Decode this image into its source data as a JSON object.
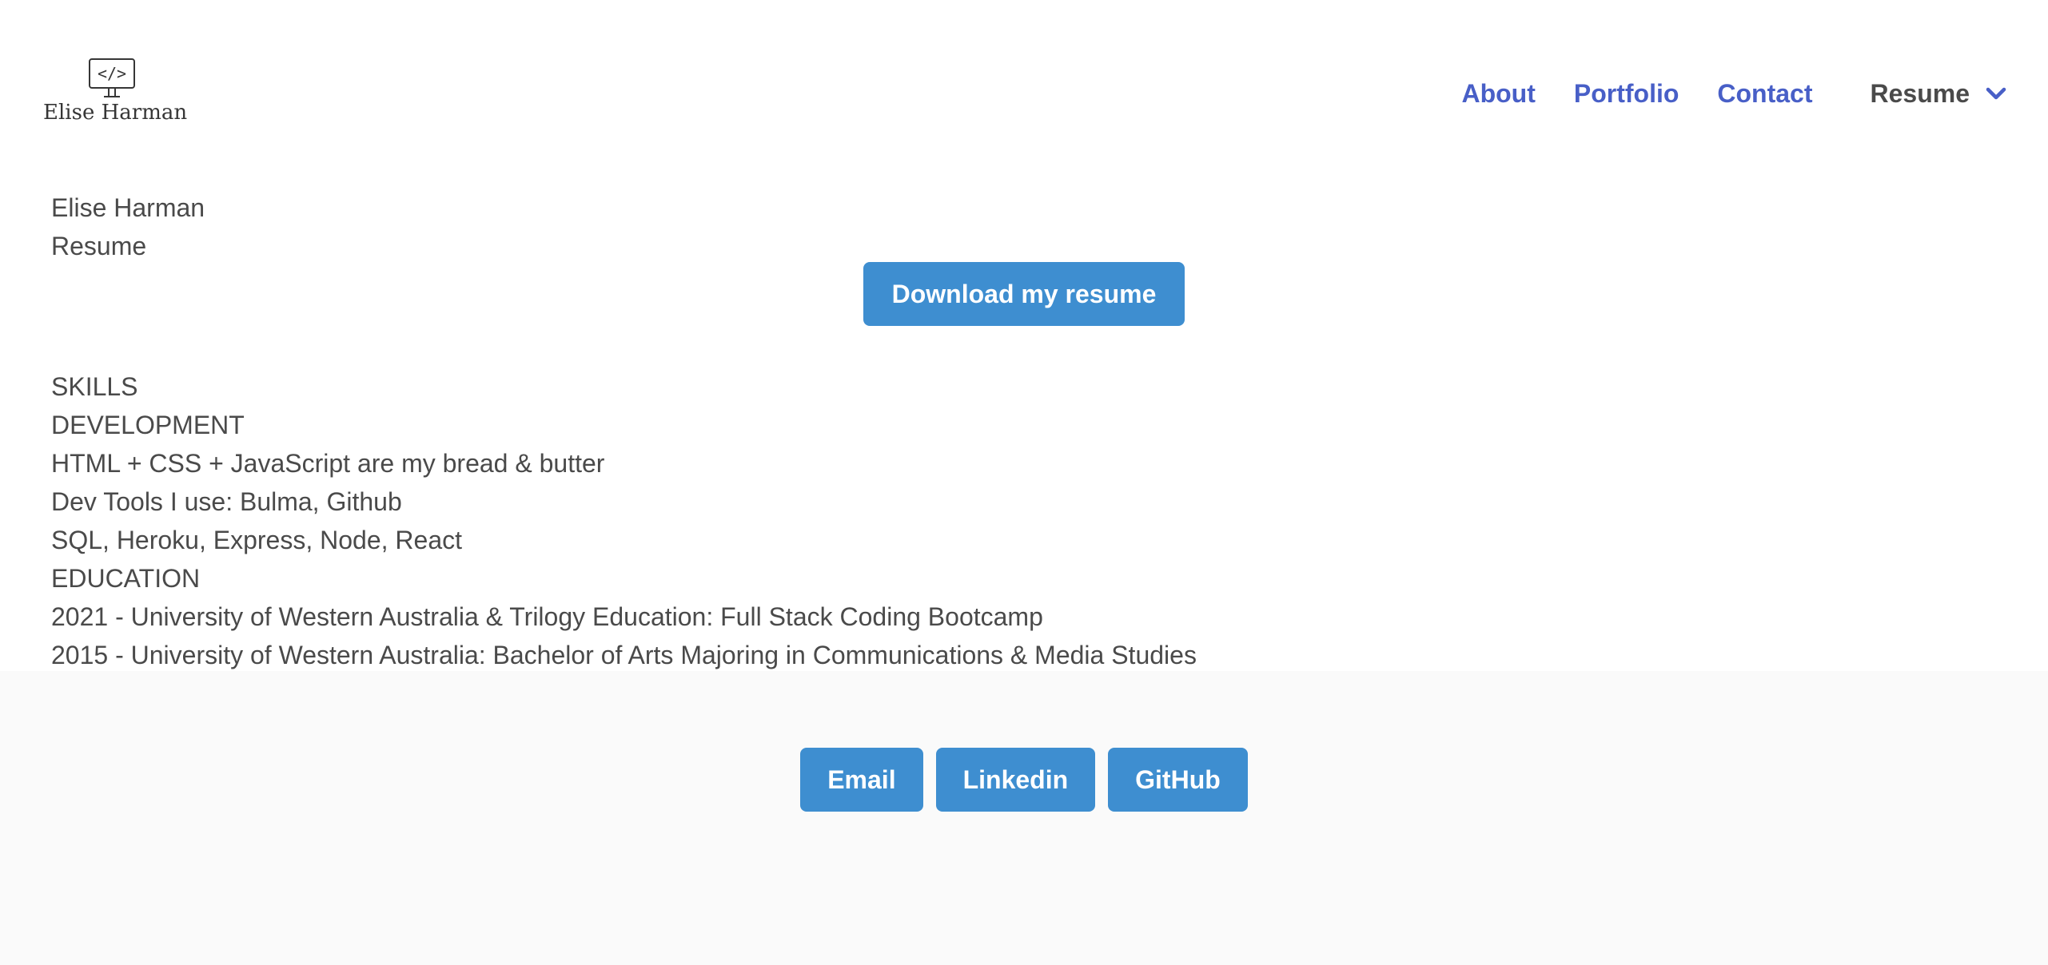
{
  "brand": {
    "name": "Elise Harman",
    "icon": "code-monitor-icon",
    "icon_glyph": "</>"
  },
  "nav": {
    "links": [
      "About",
      "Portfolio",
      "Contact"
    ],
    "dropdown_label": "Resume",
    "dropdown_icon": "chevron-down-icon",
    "link_color": "#485fc7"
  },
  "main": {
    "name": "Elise Harman",
    "page_label": "Resume",
    "download_button": "Download my resume",
    "skills_heading": "SKILLS",
    "development_heading": "DEVELOPMENT",
    "skills": [
      "HTML + CSS + JavaScript are my bread & butter",
      "Dev Tools I use: Bulma, Github",
      "SQL, Heroku, Express, Node, React"
    ],
    "education_heading": "EDUCATION",
    "education": [
      "2021 - University of Western Australia & Trilogy Education: Full Stack Coding Bootcamp",
      "2015 - University of Western Australia: Bachelor of Arts Majoring in Communications & Media Studies"
    ]
  },
  "footer": {
    "buttons": [
      "Email",
      "Linkedin",
      "GitHub"
    ],
    "button_color": "#3e8ed0",
    "background": "#fafafa"
  }
}
